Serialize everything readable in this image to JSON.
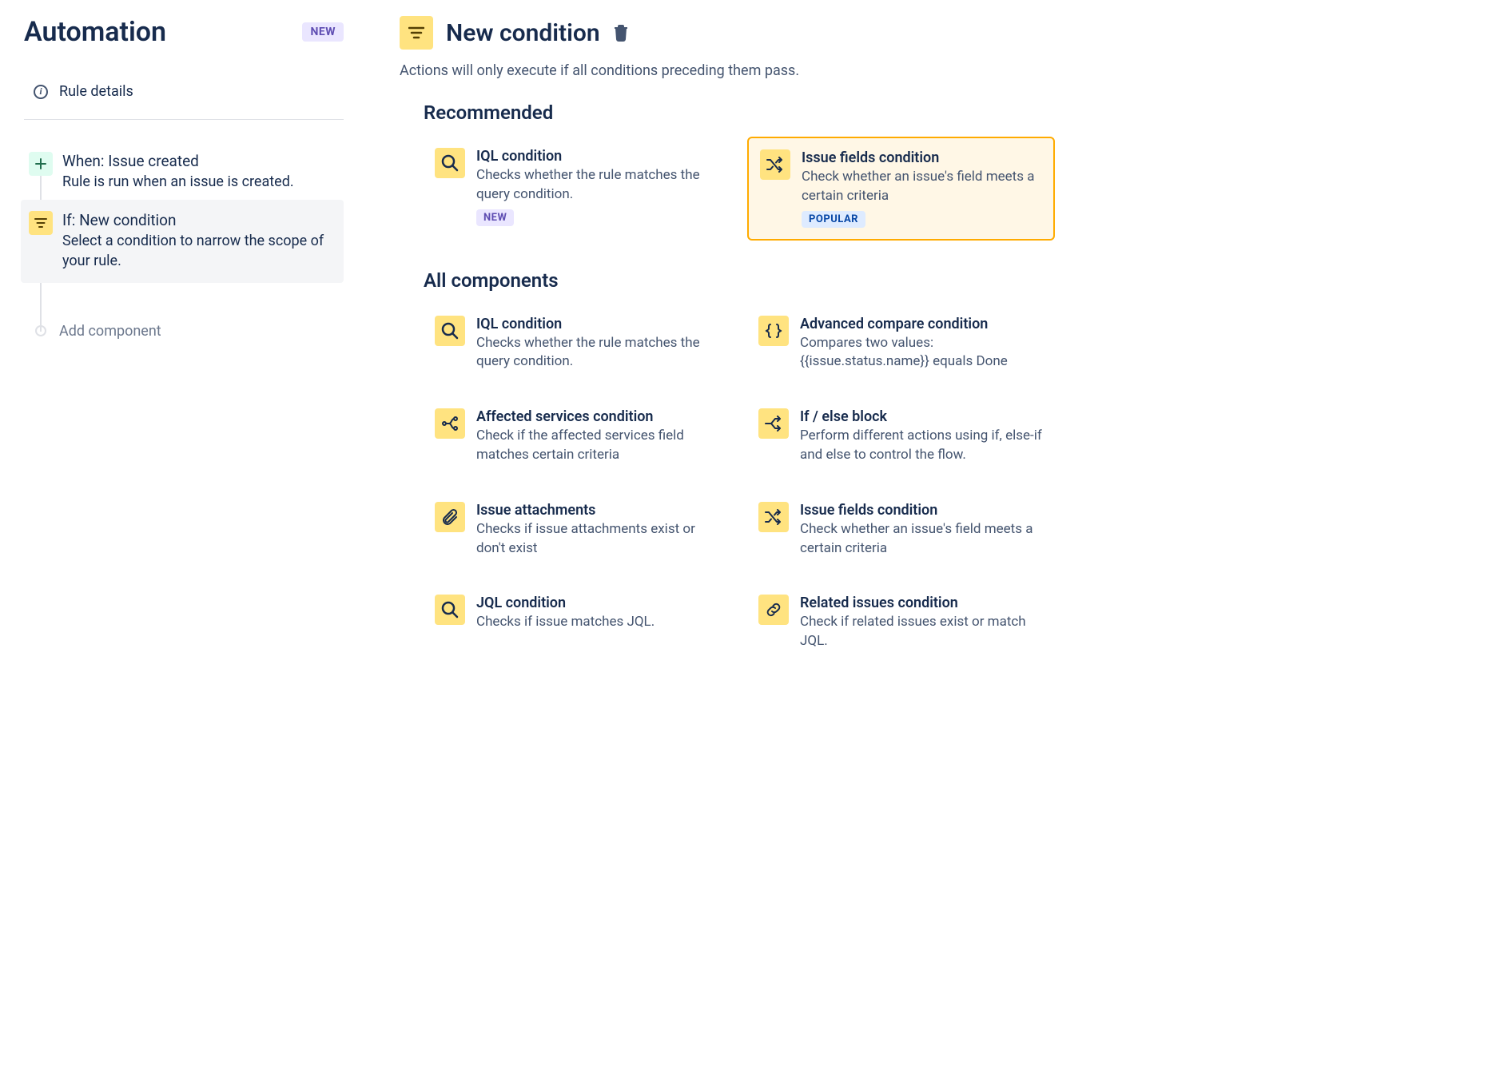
{
  "page": {
    "title": "Automation",
    "new_badge": "NEW"
  },
  "sidebar": {
    "rule_details": "Rule details",
    "steps": [
      {
        "title": "When: Issue created",
        "desc": "Rule is run when an issue is created."
      },
      {
        "title": "If: New condition",
        "desc": "Select a condition to narrow the scope of your rule."
      }
    ],
    "add_component": "Add component"
  },
  "main": {
    "title": "New condition",
    "subtitle": "Actions will only execute if all conditions preceding them pass.",
    "sections": {
      "recommended": "Recommended",
      "all": "All components"
    },
    "recommended": [
      {
        "icon": "search",
        "title": "IQL condition",
        "desc": "Checks whether the rule matches the query condition.",
        "badge": "NEW"
      },
      {
        "icon": "shuffle",
        "title": "Issue fields condition",
        "desc": "Check whether an issue's field meets a certain criteria",
        "badge": "POPULAR",
        "highlighted": true
      }
    ],
    "all": [
      {
        "icon": "search",
        "title": "IQL condition",
        "desc": "Checks whether the rule matches the query condition."
      },
      {
        "icon": "braces",
        "title": "Advanced compare condition",
        "desc": "Compares two values: {{issue.status.name}} equals Done"
      },
      {
        "icon": "branch",
        "title": "Affected services condition",
        "desc": "Check if the affected services field matches certain criteria"
      },
      {
        "icon": "split",
        "title": "If / else block",
        "desc": "Perform different actions using if, else-if and else to control the flow."
      },
      {
        "icon": "attachment",
        "title": "Issue attachments",
        "desc": "Checks if issue attachments exist or don't exist"
      },
      {
        "icon": "shuffle",
        "title": "Issue fields condition",
        "desc": "Check whether an issue's field meets a certain criteria"
      },
      {
        "icon": "search",
        "title": "JQL condition",
        "desc": "Checks if issue matches JQL."
      },
      {
        "icon": "link",
        "title": "Related issues condition",
        "desc": "Check if related issues exist or match JQL."
      }
    ]
  }
}
